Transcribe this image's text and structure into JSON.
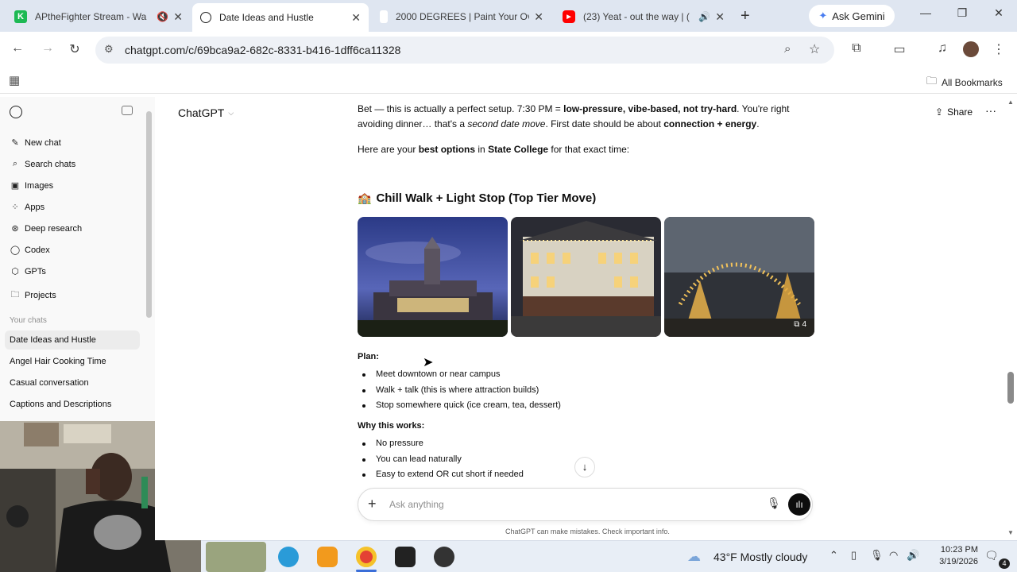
{
  "browser": {
    "tabs": [
      {
        "title": "APtheFighter Stream - Wa",
        "favicon_color": "#1db954",
        "favicon_letter": "K",
        "muted": true
      },
      {
        "title": "Date Ideas and Hustle",
        "favicon_color": "#111111",
        "active": true
      },
      {
        "title": "2000 DEGREES | Paint Your Ov",
        "favicon_color": "#ffffff"
      },
      {
        "title": "(23) Yeat - out the way | (",
        "favicon_color": "#ff0000",
        "audio": true
      }
    ],
    "new_tab": "+",
    "ask_gemini": "Ask Gemini",
    "url": "chatgpt.com/c/69bca9a2-682c-8331-b416-1dff6ca11328",
    "all_bookmarks": "All Bookmarks"
  },
  "sidebar": {
    "items": [
      {
        "label": "New chat",
        "icon": "edit-icon"
      },
      {
        "label": "Search chats",
        "icon": "search-icon"
      },
      {
        "label": "Images",
        "icon": "image-icon"
      },
      {
        "label": "Apps",
        "icon": "apps-icon"
      },
      {
        "label": "Deep research",
        "icon": "telescope-icon"
      },
      {
        "label": "Codex",
        "icon": "codex-icon"
      },
      {
        "label": "GPTs",
        "icon": "gpts-icon"
      },
      {
        "label": "Projects",
        "icon": "folder-icon"
      }
    ],
    "your_chats_label": "Your chats",
    "chats": [
      "Date Ideas and Hustle",
      "Angel Hair Cooking Time",
      "Casual conversation",
      "Captions and Descriptions"
    ]
  },
  "header": {
    "model": "ChatGPT",
    "share": "Share"
  },
  "message": {
    "intro_1": "Bet — this is actually a perfect setup. 7:30 PM = ",
    "intro_1_bold": "low-pressure, vibe-based, not try-hard",
    "intro_1_end": ". You're right",
    "intro_2": "avoiding dinner… that's a ",
    "intro_2_italic": "second date move",
    "intro_2_mid": ". First date should be about ",
    "intro_2_bold": "connection + energy",
    "intro_2_end": ".",
    "intro_3": "Here are your ",
    "intro_3_bold1": "best options",
    "intro_3_mid": " in ",
    "intro_3_bold2": "State College",
    "intro_3_end": " for that exact time:",
    "section_emoji": "🏫",
    "section_title": "Chill Walk + Light Stop (Top Tier Move)",
    "photo_count": "4",
    "plan_label": "Plan:",
    "plan_items": [
      "Meet downtown or near campus",
      "Walk + talk (this is where attraction builds)",
      "Stop somewhere quick (ice cream, tea, dessert)"
    ],
    "why_label": "Why this works:",
    "why_items": [
      "No pressure",
      "You can lead naturally",
      "Easy to extend OR cut short if needed"
    ]
  },
  "composer": {
    "placeholder": "Ask anything",
    "disclaimer": "ChatGPT can make mistakes. Check important info."
  },
  "taskbar": {
    "weather_temp": "43°F",
    "weather_desc": "Mostly cloudy",
    "time": "10:23 PM",
    "date": "3/19/2026",
    "notification_count": "4"
  }
}
